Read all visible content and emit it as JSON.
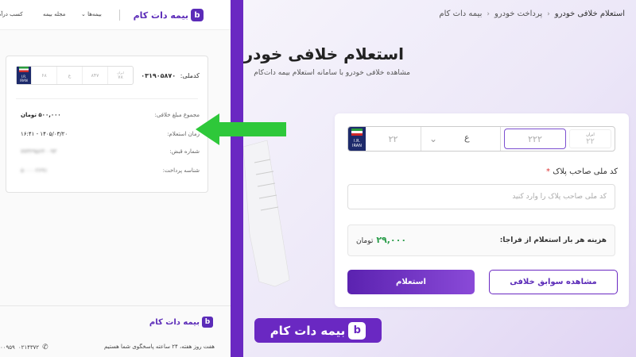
{
  "left_panel": {
    "topnav": {
      "logo_text": "بیمه دات کام",
      "logo_glyph": "b",
      "menu_insurances": "بیمه‌ها",
      "menu_magazine": "مجله بیمه",
      "menu_earn": "کسب درآمد"
    },
    "result_card": {
      "national_code_label": "کدملی:",
      "national_code_value": "۰۳۱۹۰۵۸۷۰",
      "mini_plate": {
        "flag_line1": "I.R.",
        "flag_line2": "IRAN",
        "cells": [
          "۶۸",
          "ع",
          "۸۴۷"
        ],
        "province_label": "ایران",
        "province_value": "۷۸"
      },
      "rows": [
        {
          "label": "مجموع مبلغ خلافی:",
          "value": "۵۰۰,۰۰۰ تومان"
        },
        {
          "label": "زمان استعلام:",
          "value": "۱۴۰۵/۰۳/۲۰ - ۱۶:۴۱"
        },
        {
          "label": "شماره قبض:",
          "value": "۷۷۳۲۹۵۶۴۰۰۹۳"
        },
        {
          "label": "شناسه پرداخت:",
          "value": "۵۰۰۰۰۲۶۹۱"
        }
      ]
    },
    "footer": {
      "logo_text": "بیمه دات کام",
      "logo_glyph": "b",
      "support_text": "هفت روز هفته، ۲۴ ساعته پاسخگوی شما هستیم",
      "phone1": "۰۲۱۴۳۷۲",
      "phone2": "۰۰۹۵۹"
    }
  },
  "right_panel": {
    "breadcrumb": {
      "home": "بیمه دات کام",
      "section": "پرداخت خودرو",
      "current": "استعلام خلافی خودرو"
    },
    "title": "استعلام خلافی خودرو",
    "subtitle": "مشاهده خلافی خودرو با سامانه استعلام بیمه دات‌کام",
    "plate": {
      "flag_line1": "I.R.",
      "flag_line2": "IRAN",
      "seg1_placeholder": "۲۲",
      "seg2_letter": "ع",
      "seg3_placeholder": "۲۲۲",
      "province_label": "ایران",
      "province_placeholder": "۲۲"
    },
    "national_code": {
      "label": "کد ملی صاحب پلاک",
      "required_mark": "*",
      "placeholder": "کد ملی صاحب پلاک را وارد کنید",
      "value": ""
    },
    "cost": {
      "label": "هزینه هر بار استعلام از فراجا:",
      "amount": "۲۹,۰۰۰",
      "currency": "تومان"
    },
    "buttons": {
      "history": "مشاهده سوابق خلافی",
      "inquiry": "استعلام"
    },
    "brand_badge": {
      "text": "بیمه دات کام",
      "glyph": "b"
    }
  },
  "colors": {
    "brand_purple": "#6a28c2",
    "arrow_green": "#2ec83a",
    "price_green": "#2a9d4a",
    "plate_blue": "#1d2a6b"
  }
}
